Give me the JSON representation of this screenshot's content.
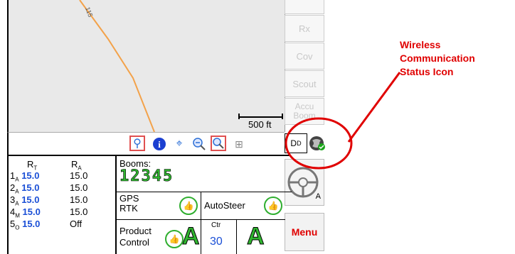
{
  "map": {
    "road_label": "115",
    "scale_text": "500 ft"
  },
  "sidebar": {
    "buttons": [
      {
        "label": "Rx"
      },
      {
        "label": "Cov"
      },
      {
        "label": "Scout"
      },
      {
        "label": "Accu Boom"
      }
    ],
    "menu_label": "Menu",
    "steering_sub": "A"
  },
  "toolbar": {
    "icons": [
      "guidance-icon",
      "info-icon",
      "center-target-icon",
      "zoom-out-icon",
      "zoom-in-icon",
      "grid-view-icon"
    ]
  },
  "status_icons": {
    "dd_label": "D",
    "dd_sub": "D"
  },
  "rates": {
    "header_rt": "R",
    "header_rt_sub": "T",
    "header_ra": "R",
    "header_ra_sub": "A",
    "rows": [
      {
        "num": "1",
        "sub": "A",
        "rt": "15.0",
        "ra": "15.0"
      },
      {
        "num": "2",
        "sub": "A",
        "rt": "15.0",
        "ra": "15.0"
      },
      {
        "num": "3",
        "sub": "A",
        "rt": "15.0",
        "ra": "15.0"
      },
      {
        "num": "4",
        "sub": "M",
        "rt": "15.0",
        "ra": "15.0"
      },
      {
        "num": "5",
        "sub": "O",
        "rt": "15.0",
        "ra": "Off"
      }
    ]
  },
  "booms": {
    "label": "Booms:",
    "values": "12345"
  },
  "gps": {
    "line1": "GPS",
    "line2": "RTK"
  },
  "autosteer": {
    "label": "AutoSteer"
  },
  "product": {
    "line1": "Product",
    "line2": "Control"
  },
  "ctr": {
    "label": "Ctr",
    "value": "30",
    "left_A": "A",
    "right_A": "A"
  },
  "annotation": {
    "line1": "Wireless",
    "line2": "Communication",
    "line3": "Status Icon"
  },
  "colors": {
    "accent_red": "#e00000",
    "rate_blue": "#1a4fd6",
    "boom_green": "#2fb52f",
    "road_orange": "#f3a24a"
  }
}
